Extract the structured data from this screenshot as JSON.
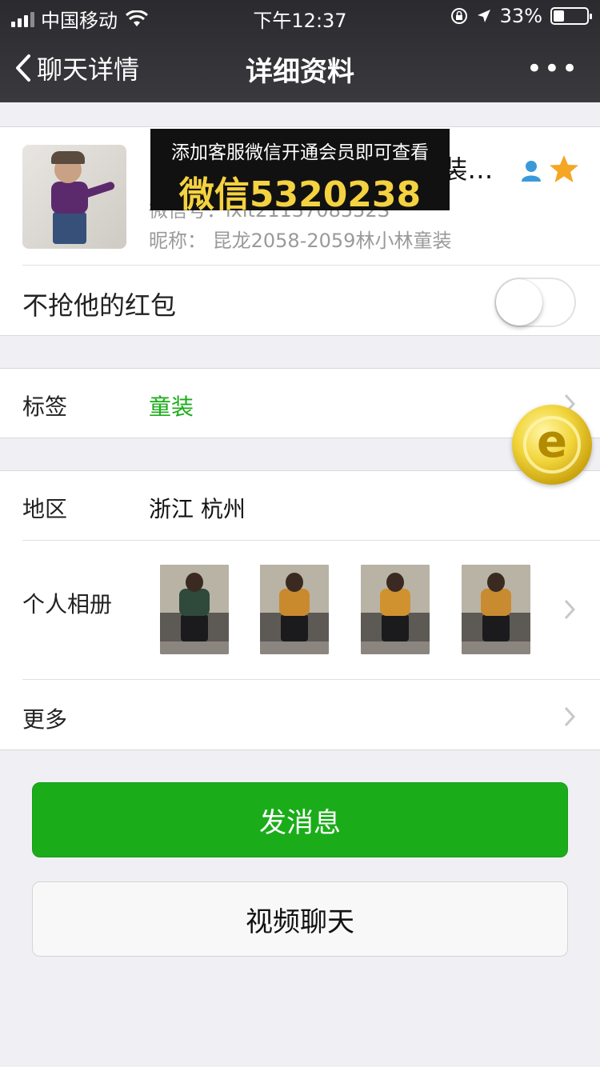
{
  "status_bar": {
    "carrier": "中国移动",
    "time": "下午12:37",
    "battery": "33%",
    "battery_level": 0.33
  },
  "nav": {
    "back_label": "聊天详情",
    "title": "详细资料",
    "more_label": "•••"
  },
  "profile": {
    "name": "昆龙2058-2059林小林童装…",
    "wechat_id": "微信号：lxlt2113708552S",
    "nickname": "昵称：  昆龙2058-2059林小林童装"
  },
  "banner": {
    "line1": "添加客服微信开通会员即可查看",
    "line2": "微信5320238"
  },
  "red_packet": {
    "label": "不抢他的红包",
    "enabled": false
  },
  "tags": {
    "label": "标签",
    "value": "童装"
  },
  "region": {
    "label": "地区",
    "value": "浙江 杭州"
  },
  "album": {
    "label": "个人相册",
    "shirt_colors": [
      "#2f4a3b",
      "#c98a2e",
      "#d0922f",
      "#c88b2f"
    ]
  },
  "more": {
    "label": "更多"
  },
  "buttons": {
    "send_message": "发消息",
    "video_chat": "视频聊天"
  },
  "colors": {
    "accent_green": "#1aad19",
    "tag_green": "#1aad19",
    "nav_bg": "#333336"
  },
  "icons": [
    "back-chevron-icon",
    "more-dots-icon",
    "user-icon",
    "star-icon",
    "chevron-right-icon",
    "coin-icon",
    "wifi-icon"
  ]
}
